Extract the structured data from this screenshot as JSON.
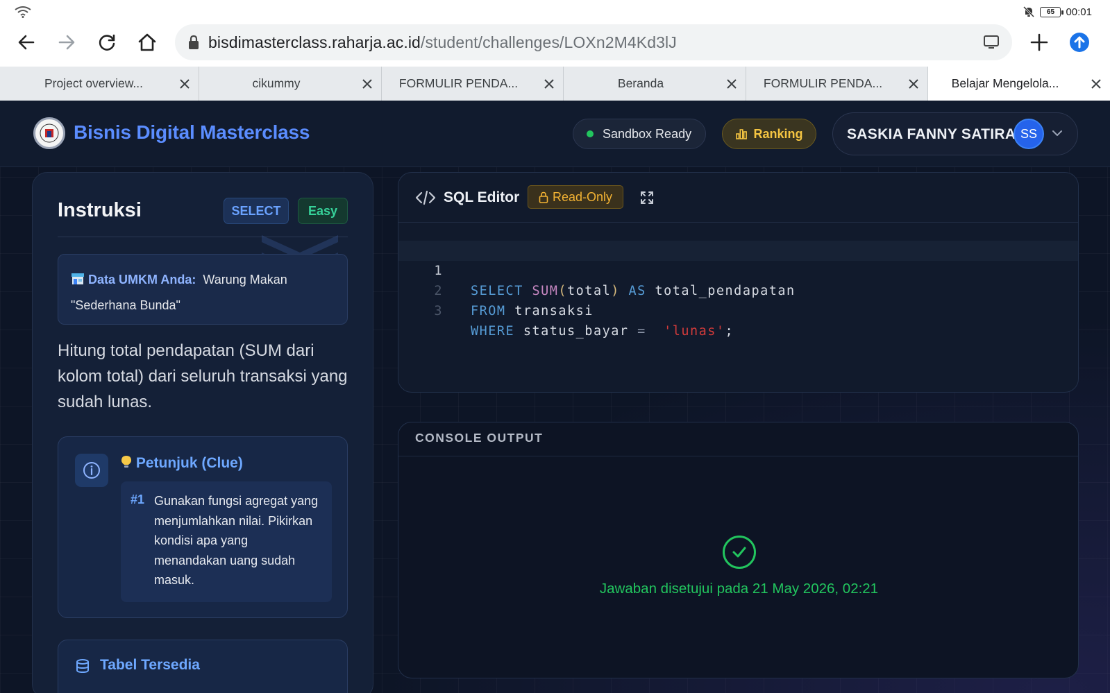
{
  "status_bar": {
    "time": "00:01",
    "battery": "65"
  },
  "browser": {
    "url_host": "bisdimasterclass.raharja.ac.id",
    "url_path": "/student/challenges/LOXn2M4Kd3lJ",
    "tabs": [
      {
        "title": "Project overview..."
      },
      {
        "title": "cikummy"
      },
      {
        "title": "FORMULIR PENDA..."
      },
      {
        "title": "Beranda"
      },
      {
        "title": "FORMULIR PENDA..."
      },
      {
        "title": "Belajar Mengelola..."
      }
    ]
  },
  "header": {
    "brand": "Bisnis Digital Masterclass",
    "sandbox_label": "Sandbox Ready",
    "ranking_label": "Ranking",
    "user_name": "SASKIA FANNY SATIRA",
    "avatar_initials": "SS"
  },
  "instructions": {
    "title": "Instruksi",
    "tag_category": "SELECT",
    "tag_difficulty": "Easy",
    "umkm_label": "Data UMKM Anda:",
    "umkm_value_1": "Warung Makan",
    "umkm_value_2": "\"Sederhana Bunda\"",
    "task": "Hitung total pendapatan (SUM dari kolom total) dari seluruh transaksi yang sudah lunas.",
    "clue_title": "Petunjuk (Clue)",
    "clue_number": "#1",
    "clue_text": "Gunakan fungsi agregat yang menjumlahkan nilai. Pikirkan kondisi apa yang menandakan uang sudah masuk.",
    "tables_title": "Tabel Tersedia"
  },
  "editor": {
    "title": "SQL Editor",
    "readonly_label": "Read-Only",
    "lines": [
      {
        "num": "1",
        "tokens": [
          [
            "kw",
            "SELECT"
          ],
          [
            "",
            ""
          ],
          [
            "fn",
            "SUM"
          ],
          [
            "par",
            "("
          ],
          [
            "",
            "total"
          ],
          [
            "par",
            ")"
          ],
          [
            "",
            ""
          ],
          [
            "kw",
            "AS"
          ],
          [
            "",
            "total_pendapatan"
          ]
        ]
      },
      {
        "num": "2",
        "tokens": [
          [
            "kw",
            "FROM"
          ],
          [
            "",
            "transaksi"
          ]
        ]
      },
      {
        "num": "3",
        "tokens": [
          [
            "kw",
            "WHERE"
          ],
          [
            "",
            "status_bayar"
          ],
          [
            "op",
            "="
          ],
          [
            "str",
            "'lunas'"
          ],
          [
            "",
            ";"
          ]
        ]
      }
    ]
  },
  "console": {
    "title": "CONSOLE OUTPUT",
    "message": "Jawaban disetujui pada 21 May 2026, 02:21"
  },
  "colors": {
    "brand": "#5b8dff",
    "success": "#22c55e",
    "ranking": "#f5c542",
    "readonly": "#f2b233"
  }
}
